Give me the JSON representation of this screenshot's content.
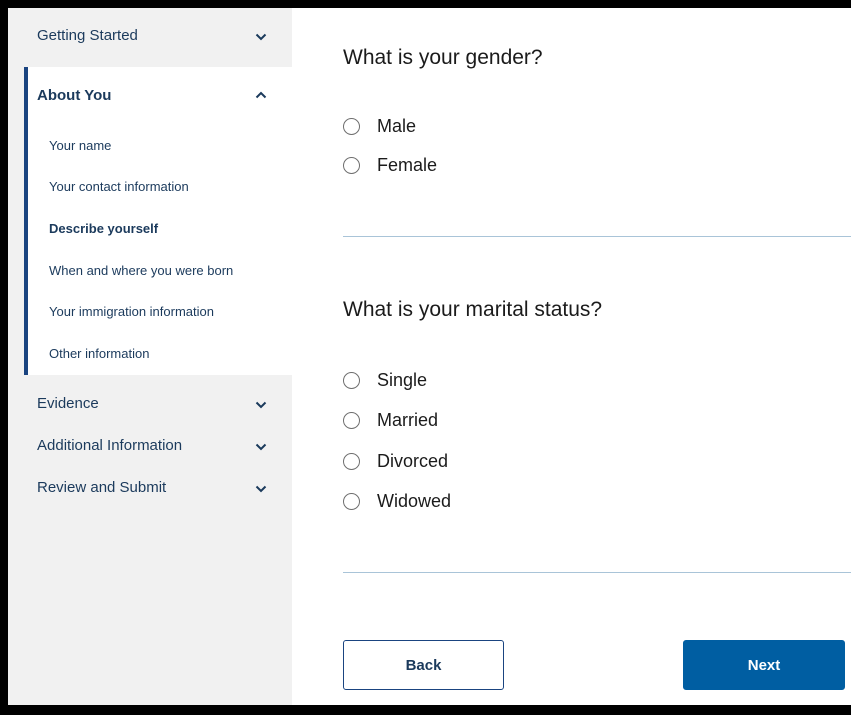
{
  "sidebar": {
    "sections": [
      {
        "label": "Getting Started",
        "expanded": false
      },
      {
        "label": "About You",
        "expanded": true
      },
      {
        "label": "Evidence",
        "expanded": false
      },
      {
        "label": "Additional Information",
        "expanded": false
      },
      {
        "label": "Review and Submit",
        "expanded": false
      }
    ],
    "about_you_items": [
      {
        "label": "Your name"
      },
      {
        "label": "Your contact information"
      },
      {
        "label": "Describe yourself",
        "current": true
      },
      {
        "label": "When and where you were born"
      },
      {
        "label": "Your immigration information"
      },
      {
        "label": "Other information"
      }
    ]
  },
  "main": {
    "gender": {
      "question": "What is your gender?",
      "options": [
        "Male",
        "Female"
      ]
    },
    "marital": {
      "question": "What is your marital status?",
      "options": [
        "Single",
        "Married",
        "Divorced",
        "Widowed"
      ]
    },
    "buttons": {
      "back": "Back",
      "next": "Next"
    }
  },
  "colors": {
    "sidebar_bg": "#f1f1f1",
    "accent": "#1a4480",
    "primary_button": "#005ea2",
    "text": "#1b3a5c"
  },
  "icons": {
    "collapsed": "chevron-down-icon",
    "expanded": "chevron-up-icon"
  }
}
